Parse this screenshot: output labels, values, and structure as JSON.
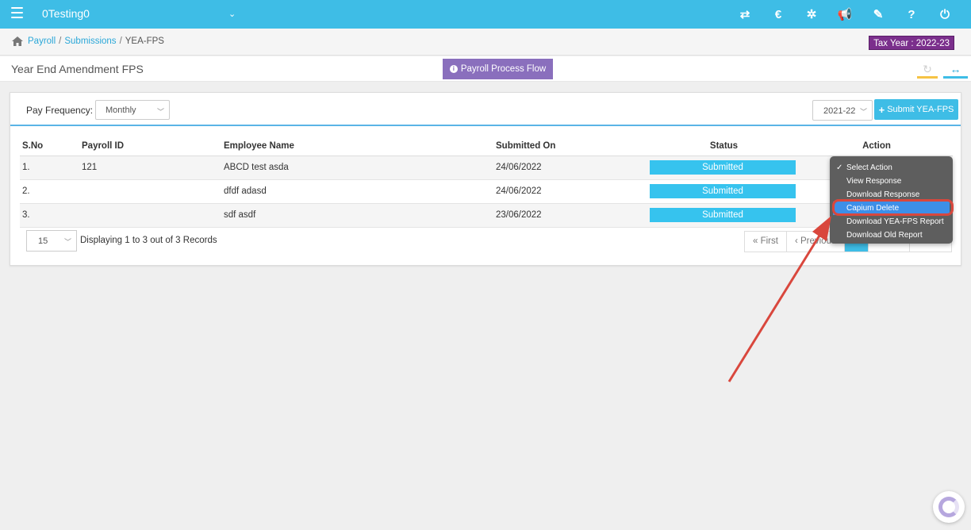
{
  "topbar": {
    "app_name": "0Testing0",
    "icons": [
      "transfer-icon",
      "currency-icon",
      "cogs-icon",
      "megaphone-icon",
      "tag-icon",
      "help-icon",
      "power-icon"
    ],
    "icon_glyphs": [
      "⇄",
      "€",
      "✲",
      "📢",
      "✎",
      "?",
      "⏻"
    ]
  },
  "breadcrumb": {
    "items": [
      "Payroll",
      "Submissions",
      "YEA-FPS"
    ],
    "sep": "/"
  },
  "tax_year": "Tax Year : 2022-23",
  "page_title": "Year End Amendment FPS",
  "flow_button": "Payroll Process Flow",
  "filters": {
    "pay_frequency_label": "Pay Frequency:",
    "pay_frequency_value": "Monthly",
    "year_value": "2021-22",
    "submit_label": "Submit YEA-FPS"
  },
  "table": {
    "headers": [
      "S.No",
      "Payroll ID",
      "Employee Name",
      "Submitted On",
      "Status",
      "Action"
    ],
    "rows": [
      {
        "sno": "1.",
        "payroll_id": "121",
        "name": "ABCD test asda",
        "submitted_on": "24/06/2022",
        "status": "Submitted"
      },
      {
        "sno": "2.",
        "payroll_id": "",
        "name": "dfdf adasd",
        "submitted_on": "24/06/2022",
        "status": "Submitted"
      },
      {
        "sno": "3.",
        "payroll_id": "",
        "name": "sdf asdf",
        "submitted_on": "23/06/2022",
        "status": "Submitted"
      }
    ]
  },
  "pagination": {
    "page_size": "15",
    "record_text": "Displaying 1 to 3 out of 3 Records",
    "first": "« First",
    "previous": "‹ Previous"
  },
  "action_menu": {
    "items": [
      "Select Action",
      "View Response",
      "Download Response",
      "Capium Delete",
      "Download YEA-FPS Report",
      "Download Old Report"
    ],
    "selected_index": 0,
    "highlighted_index": 3
  },
  "colors": {
    "primary": "#3ebde6",
    "tax_badge": "#7b2f8c",
    "flow_button": "#8a6fbd",
    "annotation": "#d9473d"
  }
}
